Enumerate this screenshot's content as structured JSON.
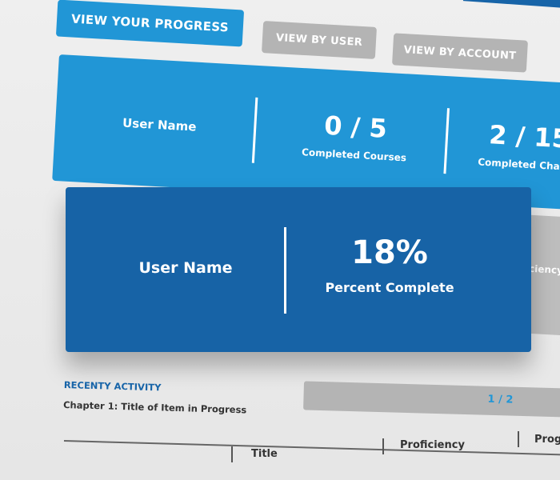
{
  "tabs": {
    "view_progress": "VIEW YOUR PROGRESS",
    "view_by_user": "VIEW BY USER",
    "view_by_account": "VIEW BY ACCOUNT"
  },
  "summary": {
    "user_name": "User Name",
    "courses_value": "0 / 5",
    "courses_label": "Completed Courses",
    "chapters_value": "2 / 15",
    "chapters_label": "Completed Chapte"
  },
  "detail": {
    "user_name": "User Name",
    "percent_value": "18%",
    "percent_label": "Percent Complete",
    "side_label": "ficiency"
  },
  "activity": {
    "title": "RECENTY ACTIVITY",
    "subtitle": "Chapter 1: Title of Item in Progress",
    "pager": "1 / 2"
  },
  "table": {
    "headers": [
      "Title",
      "Proficiency",
      "Progr"
    ]
  },
  "colors": {
    "primary_blue": "#2196d6",
    "dark_blue": "#1763a6",
    "inactive_grey": "#b4b4b4"
  },
  "progress": {
    "percent_complete": 18
  }
}
